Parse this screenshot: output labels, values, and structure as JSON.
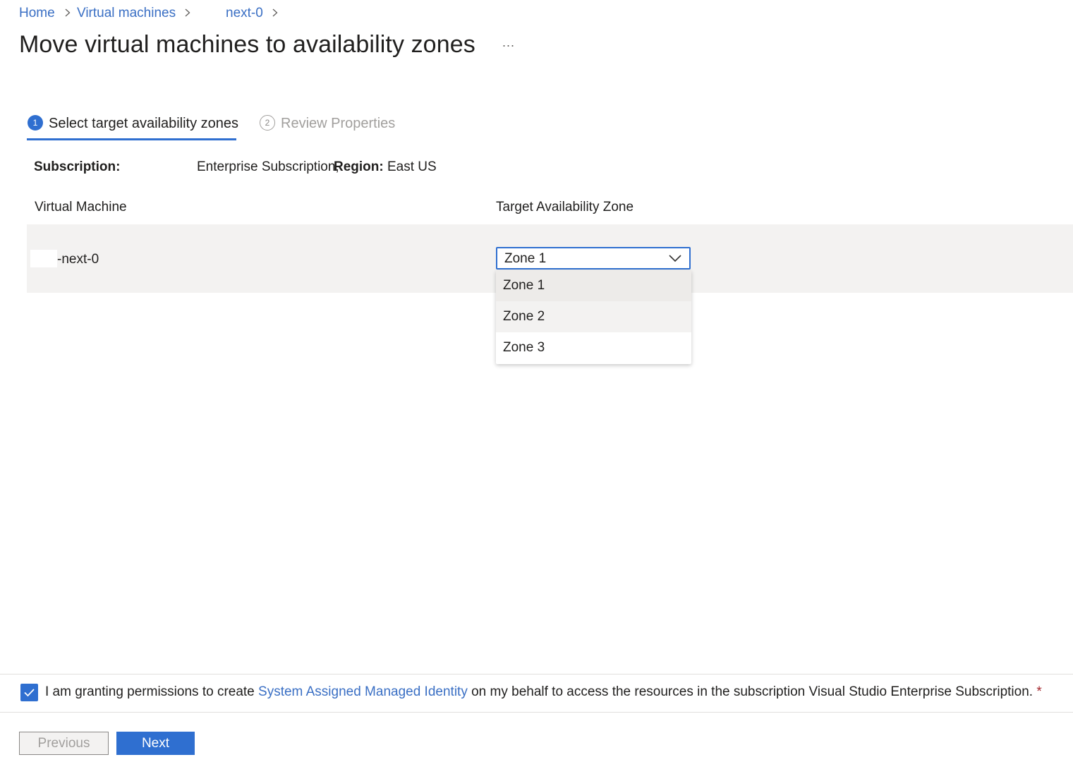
{
  "breadcrumb": {
    "items": [
      {
        "label": "Home"
      },
      {
        "label": "Virtual machines"
      },
      {
        "label": "next-0"
      }
    ]
  },
  "header": {
    "title": "Move virtual machines to availability zones",
    "more_label": "..."
  },
  "wizard": {
    "steps": [
      {
        "number": "1",
        "label": "Select target availability zones",
        "state": "active"
      },
      {
        "number": "2",
        "label": "Review Properties",
        "state": "inactive"
      }
    ]
  },
  "subscription": {
    "label": "Subscription:",
    "value": "Enterprise Subscription,",
    "region_label": "Region:",
    "region_value": "East US"
  },
  "table": {
    "columns": [
      "Virtual Machine",
      "Target Availability Zone"
    ],
    "rows": [
      {
        "vm": "-next-0",
        "zone": "Zone 1"
      }
    ]
  },
  "dropdown": {
    "selected": "Zone 1",
    "options": [
      "Zone 1",
      "Zone 2",
      "Zone 3"
    ],
    "expanded": true
  },
  "consent": {
    "checked": true,
    "text_before": "I am granting permissions to create ",
    "link_text": "System Assigned Managed Identity",
    "text_after": " on my behalf to access the resources in the subscription Visual Studio Enterprise Subscription. ",
    "required_mark": "*"
  },
  "footer": {
    "previous_label": "Previous",
    "next_label": "Next"
  },
  "colors": {
    "accent": "#2f6fd0",
    "link": "#3a6fc4",
    "row_background": "#f3f2f1",
    "required": "#a4262c"
  },
  "icons": [
    "chevron-right-icon",
    "chevron-down-icon",
    "checkmark-icon",
    "more-icon"
  ]
}
